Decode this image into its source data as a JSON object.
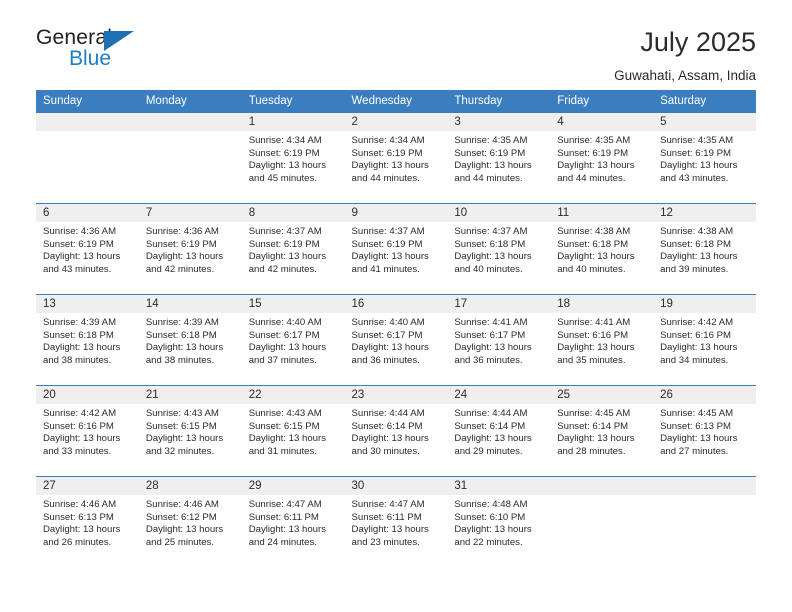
{
  "brand": {
    "name_top": "General",
    "name_bottom": "Blue",
    "accent_color": "#1f7ec2",
    "triangle_color": "#1f6fb5"
  },
  "header": {
    "title": "July 2025",
    "subtitle": "Guwahati, Assam, India"
  },
  "theme": {
    "header_bg": "#3a7ec0",
    "header_text": "#ffffff",
    "daynum_band_bg": "#efefef",
    "row_divider": "#3a7ec0",
    "body_text": "#2b2b2b"
  },
  "calendar": {
    "weekday_headers": [
      "Sunday",
      "Monday",
      "Tuesday",
      "Wednesday",
      "Thursday",
      "Friday",
      "Saturday"
    ],
    "labels": {
      "sunrise": "Sunrise:",
      "sunset": "Sunset:",
      "daylight": "Daylight:"
    },
    "weeks": [
      [
        {
          "day": "",
          "sunrise": "",
          "sunset": "",
          "daylight": ""
        },
        {
          "day": "",
          "sunrise": "",
          "sunset": "",
          "daylight": ""
        },
        {
          "day": "1",
          "sunrise": "Sunrise: 4:34 AM",
          "sunset": "Sunset: 6:19 PM",
          "daylight": "Daylight: 13 hours and 45 minutes."
        },
        {
          "day": "2",
          "sunrise": "Sunrise: 4:34 AM",
          "sunset": "Sunset: 6:19 PM",
          "daylight": "Daylight: 13 hours and 44 minutes."
        },
        {
          "day": "3",
          "sunrise": "Sunrise: 4:35 AM",
          "sunset": "Sunset: 6:19 PM",
          "daylight": "Daylight: 13 hours and 44 minutes."
        },
        {
          "day": "4",
          "sunrise": "Sunrise: 4:35 AM",
          "sunset": "Sunset: 6:19 PM",
          "daylight": "Daylight: 13 hours and 44 minutes."
        },
        {
          "day": "5",
          "sunrise": "Sunrise: 4:35 AM",
          "sunset": "Sunset: 6:19 PM",
          "daylight": "Daylight: 13 hours and 43 minutes."
        }
      ],
      [
        {
          "day": "6",
          "sunrise": "Sunrise: 4:36 AM",
          "sunset": "Sunset: 6:19 PM",
          "daylight": "Daylight: 13 hours and 43 minutes."
        },
        {
          "day": "7",
          "sunrise": "Sunrise: 4:36 AM",
          "sunset": "Sunset: 6:19 PM",
          "daylight": "Daylight: 13 hours and 42 minutes."
        },
        {
          "day": "8",
          "sunrise": "Sunrise: 4:37 AM",
          "sunset": "Sunset: 6:19 PM",
          "daylight": "Daylight: 13 hours and 42 minutes."
        },
        {
          "day": "9",
          "sunrise": "Sunrise: 4:37 AM",
          "sunset": "Sunset: 6:19 PM",
          "daylight": "Daylight: 13 hours and 41 minutes."
        },
        {
          "day": "10",
          "sunrise": "Sunrise: 4:37 AM",
          "sunset": "Sunset: 6:18 PM",
          "daylight": "Daylight: 13 hours and 40 minutes."
        },
        {
          "day": "11",
          "sunrise": "Sunrise: 4:38 AM",
          "sunset": "Sunset: 6:18 PM",
          "daylight": "Daylight: 13 hours and 40 minutes."
        },
        {
          "day": "12",
          "sunrise": "Sunrise: 4:38 AM",
          "sunset": "Sunset: 6:18 PM",
          "daylight": "Daylight: 13 hours and 39 minutes."
        }
      ],
      [
        {
          "day": "13",
          "sunrise": "Sunrise: 4:39 AM",
          "sunset": "Sunset: 6:18 PM",
          "daylight": "Daylight: 13 hours and 38 minutes."
        },
        {
          "day": "14",
          "sunrise": "Sunrise: 4:39 AM",
          "sunset": "Sunset: 6:18 PM",
          "daylight": "Daylight: 13 hours and 38 minutes."
        },
        {
          "day": "15",
          "sunrise": "Sunrise: 4:40 AM",
          "sunset": "Sunset: 6:17 PM",
          "daylight": "Daylight: 13 hours and 37 minutes."
        },
        {
          "day": "16",
          "sunrise": "Sunrise: 4:40 AM",
          "sunset": "Sunset: 6:17 PM",
          "daylight": "Daylight: 13 hours and 36 minutes."
        },
        {
          "day": "17",
          "sunrise": "Sunrise: 4:41 AM",
          "sunset": "Sunset: 6:17 PM",
          "daylight": "Daylight: 13 hours and 36 minutes."
        },
        {
          "day": "18",
          "sunrise": "Sunrise: 4:41 AM",
          "sunset": "Sunset: 6:16 PM",
          "daylight": "Daylight: 13 hours and 35 minutes."
        },
        {
          "day": "19",
          "sunrise": "Sunrise: 4:42 AM",
          "sunset": "Sunset: 6:16 PM",
          "daylight": "Daylight: 13 hours and 34 minutes."
        }
      ],
      [
        {
          "day": "20",
          "sunrise": "Sunrise: 4:42 AM",
          "sunset": "Sunset: 6:16 PM",
          "daylight": "Daylight: 13 hours and 33 minutes."
        },
        {
          "day": "21",
          "sunrise": "Sunrise: 4:43 AM",
          "sunset": "Sunset: 6:15 PM",
          "daylight": "Daylight: 13 hours and 32 minutes."
        },
        {
          "day": "22",
          "sunrise": "Sunrise: 4:43 AM",
          "sunset": "Sunset: 6:15 PM",
          "daylight": "Daylight: 13 hours and 31 minutes."
        },
        {
          "day": "23",
          "sunrise": "Sunrise: 4:44 AM",
          "sunset": "Sunset: 6:14 PM",
          "daylight": "Daylight: 13 hours and 30 minutes."
        },
        {
          "day": "24",
          "sunrise": "Sunrise: 4:44 AM",
          "sunset": "Sunset: 6:14 PM",
          "daylight": "Daylight: 13 hours and 29 minutes."
        },
        {
          "day": "25",
          "sunrise": "Sunrise: 4:45 AM",
          "sunset": "Sunset: 6:14 PM",
          "daylight": "Daylight: 13 hours and 28 minutes."
        },
        {
          "day": "26",
          "sunrise": "Sunrise: 4:45 AM",
          "sunset": "Sunset: 6:13 PM",
          "daylight": "Daylight: 13 hours and 27 minutes."
        }
      ],
      [
        {
          "day": "27",
          "sunrise": "Sunrise: 4:46 AM",
          "sunset": "Sunset: 6:13 PM",
          "daylight": "Daylight: 13 hours and 26 minutes."
        },
        {
          "day": "28",
          "sunrise": "Sunrise: 4:46 AM",
          "sunset": "Sunset: 6:12 PM",
          "daylight": "Daylight: 13 hours and 25 minutes."
        },
        {
          "day": "29",
          "sunrise": "Sunrise: 4:47 AM",
          "sunset": "Sunset: 6:11 PM",
          "daylight": "Daylight: 13 hours and 24 minutes."
        },
        {
          "day": "30",
          "sunrise": "Sunrise: 4:47 AM",
          "sunset": "Sunset: 6:11 PM",
          "daylight": "Daylight: 13 hours and 23 minutes."
        },
        {
          "day": "31",
          "sunrise": "Sunrise: 4:48 AM",
          "sunset": "Sunset: 6:10 PM",
          "daylight": "Daylight: 13 hours and 22 minutes."
        },
        {
          "day": "",
          "sunrise": "",
          "sunset": "",
          "daylight": ""
        },
        {
          "day": "",
          "sunrise": "",
          "sunset": "",
          "daylight": ""
        }
      ]
    ]
  }
}
